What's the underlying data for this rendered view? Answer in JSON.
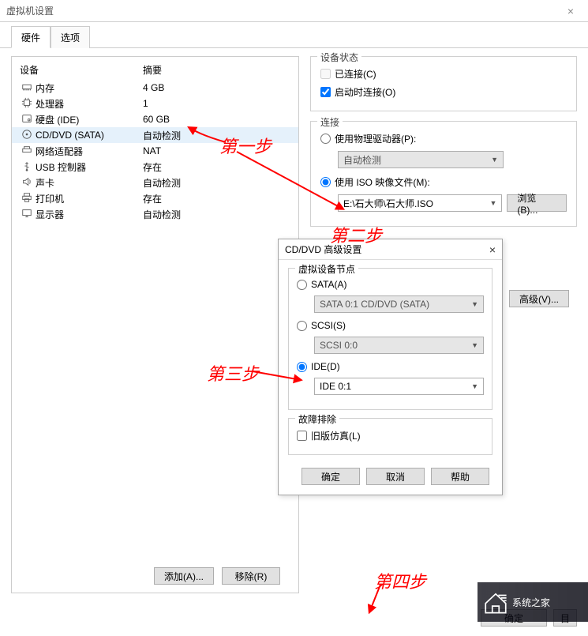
{
  "window": {
    "title": "虚拟机设置"
  },
  "tabs": {
    "hardware": "硬件",
    "options": "选项"
  },
  "headers": {
    "device": "设备",
    "summary": "摘要"
  },
  "devices": [
    {
      "name": "内存",
      "summary": "4 GB",
      "icon": "memory"
    },
    {
      "name": "处理器",
      "summary": "1",
      "icon": "cpu"
    },
    {
      "name": "硬盘 (IDE)",
      "summary": "60 GB",
      "icon": "disk"
    },
    {
      "name": "CD/DVD (SATA)",
      "summary": "自动检测",
      "icon": "cd",
      "selected": true
    },
    {
      "name": "网络适配器",
      "summary": "NAT",
      "icon": "net"
    },
    {
      "name": "USB 控制器",
      "summary": "存在",
      "icon": "usb"
    },
    {
      "name": "声卡",
      "summary": "自动检测",
      "icon": "sound"
    },
    {
      "name": "打印机",
      "summary": "存在",
      "icon": "print"
    },
    {
      "name": "显示器",
      "summary": "自动检测",
      "icon": "display"
    }
  ],
  "status": {
    "title": "设备状态",
    "connected": "已连接(C)",
    "connect_on_power": "启动时连接(O)"
  },
  "connection": {
    "title": "连接",
    "physical": "使用物理驱动器(P):",
    "physical_value": "自动检测",
    "iso": "使用 ISO 映像文件(M):",
    "iso_value": "E:\\石大师\\石大师.ISO",
    "browse": "浏览(B)..."
  },
  "buttons": {
    "add": "添加(A)...",
    "remove": "移除(R)",
    "ok": "确定",
    "cancel": "取消",
    "help": "帮助",
    "advanced": "高级(V)..."
  },
  "modal": {
    "title": "CD/DVD 高级设置",
    "node_title": "虚拟设备节点",
    "sata": "SATA(A)",
    "sata_value": "SATA 0:1   CD/DVD (SATA)",
    "scsi": "SCSI(S)",
    "scsi_value": "SCSI 0:0",
    "ide": "IDE(D)",
    "ide_value": "IDE 0:1",
    "troubleshoot_title": "故障排除",
    "legacy": "旧版仿真(L)"
  },
  "annotations": {
    "s1": "第一步",
    "s2": "第二步",
    "s3": "第三步",
    "s4": "第四步"
  },
  "watermark": "系统之家"
}
